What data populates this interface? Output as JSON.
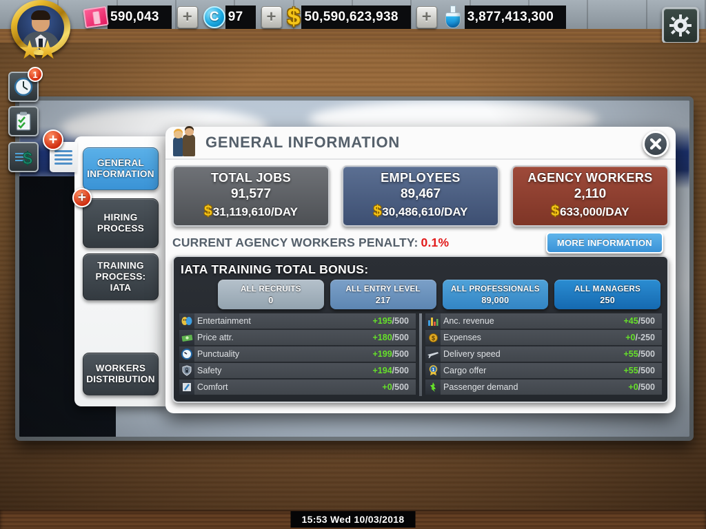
{
  "hud": {
    "resources": [
      {
        "icon": "ticket-icon",
        "value": "590,043",
        "has_plus": true,
        "plus_label": "+"
      },
      {
        "icon": "blue-coin-icon",
        "value": "97",
        "has_plus": true,
        "plus_label": "+"
      },
      {
        "icon": "dollar-icon",
        "value": "50,590,623,938",
        "has_plus": true,
        "plus_label": "+"
      },
      {
        "icon": "research-flask-icon",
        "value": "3,877,413,300",
        "has_plus": false,
        "plus_label": ""
      }
    ],
    "avatar": {
      "name": "player-avatar",
      "stars": 2
    },
    "settings_icon": "gear-icon"
  },
  "left_tools": [
    {
      "icon": "clock-icon",
      "badge": "1"
    },
    {
      "icon": "clipboard-checklist-icon",
      "badge": ""
    },
    {
      "icon": "finance-dollar-icon",
      "badge": ""
    }
  ],
  "menu_tab": {
    "icon": "hamburger-menu-icon",
    "badge": "+"
  },
  "sidebar": {
    "items": [
      {
        "label": "GENERAL INFORMATION",
        "active": true,
        "badge": ""
      },
      {
        "label": "HIRING PROCESS",
        "active": false,
        "badge": "+"
      },
      {
        "label": "TRAINING PROCESS: IATA",
        "active": false,
        "badge": ""
      },
      {
        "label": "WORKERS DISTRIBUTION",
        "active": false,
        "badge": ""
      }
    ]
  },
  "dialog": {
    "title": "GENERAL INFORMATION",
    "title_icon": "staff-couple-icon",
    "close_icon": "close-icon",
    "cards": [
      {
        "title": "TOTAL JOBS",
        "value": "91,577",
        "rate": "31,119,610/DAY",
        "currency": "$",
        "color": "#4d5054"
      },
      {
        "title": "EMPLOYEES",
        "value": "89,467",
        "rate": "30,486,610/DAY",
        "currency": "$",
        "color": "#3d4f72"
      },
      {
        "title": "AGENCY WORKERS",
        "value": "2,110",
        "rate": "633,000/DAY",
        "currency": "$",
        "color": "#7e3526"
      }
    ],
    "penalty_label": "CURRENT AGENCY WORKERS PENALTY:",
    "penalty_value": "0.1%",
    "penalty_color": "#e21b1b",
    "more_info_label": "MORE INFORMATION",
    "iata": {
      "title": "IATA TRAINING TOTAL BONUS:",
      "groups": [
        {
          "label": "ALL RECRUITS",
          "count": "0",
          "color": "#9fadb8"
        },
        {
          "label": "ALL ENTRY LEVEL",
          "count": "217",
          "color": "#6b93bd"
        },
        {
          "label": "ALL PROFESSIONALS",
          "count": "89,000",
          "color": "#3f93ce"
        },
        {
          "label": "ALL MANAGERS",
          "count": "250",
          "color": "#1f7ec4"
        }
      ],
      "left_rows": [
        {
          "icon": "theater-masks-icon",
          "label": "Entertainment",
          "bonus": "+195",
          "max": "/500"
        },
        {
          "icon": "money-bundle-icon",
          "label": "Price attr.",
          "bonus": "+180",
          "max": "/500"
        },
        {
          "icon": "stopwatch-icon",
          "label": "Punctuality",
          "bonus": "+199",
          "max": "/500"
        },
        {
          "icon": "shield-lock-icon",
          "label": "Safety",
          "bonus": "+194",
          "max": "/500"
        },
        {
          "icon": "seat-icon",
          "label": "Comfort",
          "bonus": "+0",
          "max": "/500"
        }
      ],
      "right_rows": [
        {
          "icon": "bar-chart-icon",
          "label": "Anc. revenue",
          "bonus": "+45",
          "max": "/500"
        },
        {
          "icon": "coin-icon",
          "label": "Expenses",
          "bonus": "+0",
          "max": "/-250"
        },
        {
          "icon": "airplane-icon",
          "label": "Delivery speed",
          "bonus": "+55",
          "max": "/500"
        },
        {
          "icon": "medal-icon",
          "label": "Cargo offer",
          "bonus": "+55",
          "max": "/500"
        },
        {
          "icon": "green-arrow-icon",
          "label": "Passenger demand",
          "bonus": "+0",
          "max": "/500"
        }
      ]
    }
  },
  "statusbar": {
    "clock": "15:53 Wed 10/03/2018"
  },
  "colors": {
    "accent": "#3a93d6",
    "positive": "#66e02a",
    "negative": "#e21b1b",
    "gold": "#f5c518"
  }
}
